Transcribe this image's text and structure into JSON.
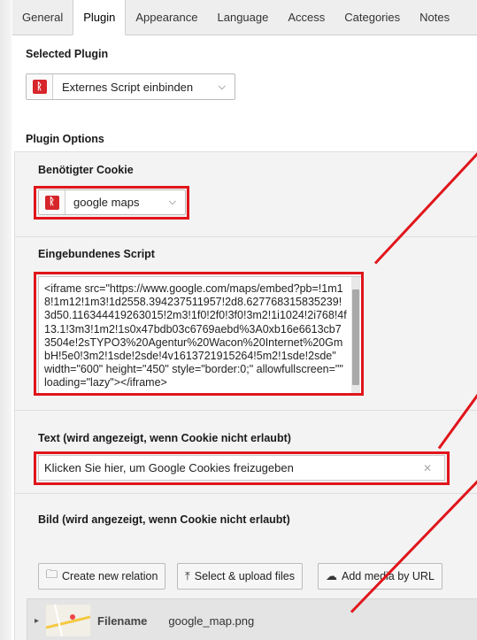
{
  "tabs": [
    "General",
    "Plugin",
    "Appearance",
    "Language",
    "Access",
    "Categories",
    "Notes"
  ],
  "active_tab": "Plugin",
  "selected_plugin": {
    "heading": "Selected Plugin",
    "value": "Externes Script einbinden"
  },
  "plugin_options": {
    "heading": "Plugin Options",
    "cookie": {
      "label": "Benötigter Cookie",
      "value": "google maps"
    },
    "script": {
      "label": "Eingebundenes Script",
      "value": "<iframe src=\"https://www.google.com/maps/embed?pb=!1m18!1m12!1m3!1d2558.394237511957!2d8.627768315835239!3d50.116344419263015!2m3!1f0!2f0!3f0!3m2!1i1024!2i768!4f13.1!3m3!1m2!1s0x47bdb03c6769aebd%3A0xb16e6613cb73504e!2sTYPO3%20Agentur%20Wacon%20Internet%20GmbH!5e0!3m2!1sde!2sde!4v1613721915264!5m2!1sde!2sde\" width=\"600\" height=\"450\" style=\"border:0;\" allowfullscreen=\"\" loading=\"lazy\"></iframe>"
    },
    "text": {
      "label": "Text (wird angezeigt, wenn Cookie nicht erlaubt)",
      "value": "Klicken Sie hier, um Google Cookies freizugeben"
    },
    "image": {
      "label": "Bild (wird angezeigt, wenn Cookie nicht erlaubt)",
      "buttons": {
        "create_relation": "Create new relation",
        "select_upload": "Select & upload files",
        "add_media": "Add media by URL"
      },
      "file": {
        "filename_label": "Filename",
        "filename_value": "google_map.png"
      }
    }
  },
  "colors": {
    "highlight_red": "#e0151b",
    "plugin_icon_red": "#d7262b"
  },
  "icons": {
    "plugin": "plugin-icon",
    "folder": "folder-icon",
    "upload": "upload-icon",
    "cloud": "cloud-icon",
    "chevron": "chevron-down-icon",
    "clear": "clear-icon",
    "expand": "expand-arrow-icon"
  }
}
